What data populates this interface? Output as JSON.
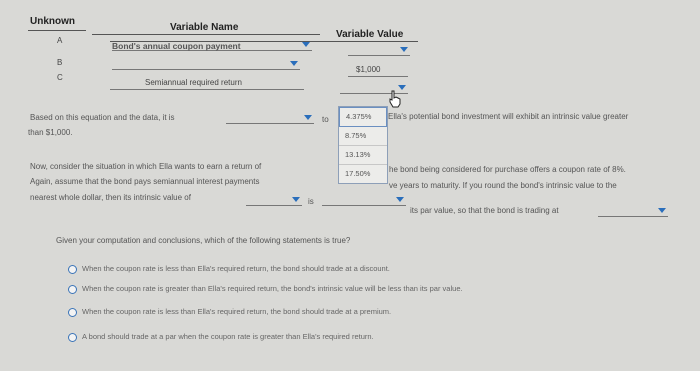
{
  "table": {
    "col_unknown": "Unknown",
    "col_name": "Variable Name",
    "col_value": "Variable Value",
    "rows": [
      {
        "letter": "A",
        "name": "Bond's annual coupon payment",
        "value": ""
      },
      {
        "letter": "B",
        "name": "",
        "value": "$1,000"
      },
      {
        "letter": "C",
        "name": "Semiannual required return",
        "value": ""
      }
    ]
  },
  "para1": {
    "line1": "Based on this equation and the data, it is",
    "to_text": "to",
    "after_options": "Ella's potential bond investment will exhibit an intrinsic value greater",
    "line2": "than $1,000."
  },
  "dropdown_options": [
    "4.375%",
    "8.75%",
    "13.13%",
    "17.50%"
  ],
  "para2": {
    "line1": "Now, consider the situation in which Ella wants to earn a return of",
    "line1_end": "he bond being considered for purchase offers a coupon rate of 8%.",
    "line2": "Again, assume that the bond pays semiannual interest payments",
    "line2_end": "ve years to maturity. If you round the bond's intrinsic value to the",
    "line3": "nearest whole dollar, then its intrinsic value of",
    "is_text": "is",
    "line3_end": "its par value, so that the bond is trading at"
  },
  "question": "Given your computation and conclusions, which of the following statements is true?",
  "choices": [
    "When the coupon rate is less than Ella's required return, the bond should trade at a discount.",
    "When the coupon rate is greater than Ella's required return, the bond's intrinsic value will be less than its par value.",
    "When the coupon rate is less than Ella's required return, the bond should trade at a premium.",
    "A bond should trade at a par when the coupon rate is greater than Ella's required return."
  ],
  "colors": {
    "accent": "#2a6ebb",
    "background": "#d9d9d6"
  }
}
